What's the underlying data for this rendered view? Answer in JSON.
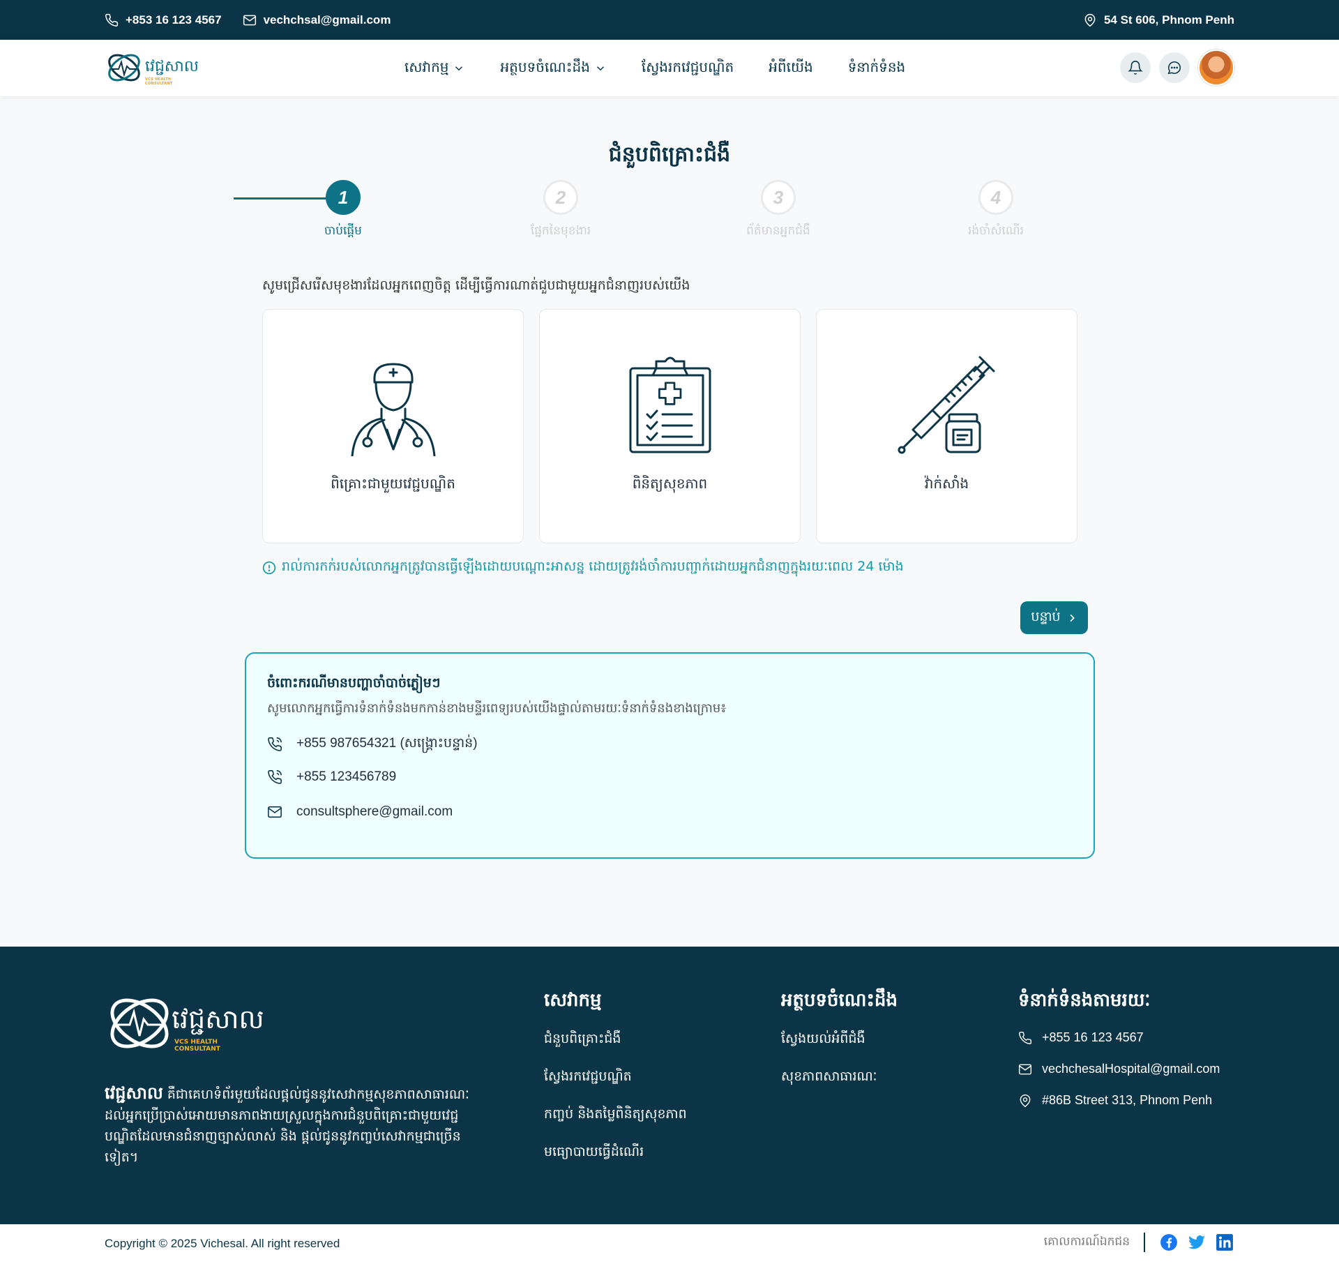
{
  "topbar": {
    "phone": "+853 16 123 4567",
    "email": "vechchsal@gmail.com",
    "address": "54 St 606, Phnom Penh"
  },
  "nav": {
    "logo_text": "វេជ្ជសាល",
    "logo_sub": "VCS HEALTH CONSULTANT",
    "menu": [
      "សេវាកម្ម",
      "អត្ថបទចំណេះដឹង",
      "ស្វែងរកវេជ្ជបណ្ឌិត",
      "អំពីយើង",
      "ទំនាក់ទំនង"
    ]
  },
  "page": {
    "title": "ជំនួបពិគ្រោះជំងឺ",
    "steps": [
      {
        "num": "1",
        "label": "ចាប់ផ្តើម"
      },
      {
        "num": "2",
        "label": "ផ្នែកនៃមុខងារ"
      },
      {
        "num": "3",
        "label": "ព័ត៌មានអ្នកជំងឺ"
      },
      {
        "num": "4",
        "label": "រង់ចាំសំណើរ"
      }
    ],
    "prompt": "សូមជ្រើសរើសមុខងារដែលអ្នកពេញចិត្ត ដើម្បីធ្វើការណាត់ជួបជាមួយអ្នកជំនាញរបស់យើង",
    "cards": [
      {
        "label": "ពិគ្រោះជាមួយវេជ្ជបណ្ឌិត",
        "icon": "doctor-icon"
      },
      {
        "label": "ពិនិត្យសុខភាព",
        "icon": "clipboard-icon"
      },
      {
        "label": "វ៉ាក់សាំង",
        "icon": "syringe-icon"
      }
    ],
    "notice": "រាល់ការកក់របស់លោកអ្នកត្រូវបានធ្វើឡើងដោយបណ្តោះអាសន្ន ដោយត្រូវរង់ចាំការបញ្ជាក់ដោយអ្នកជំនាញក្នុងរយៈពេល 24 ម៉ោង",
    "next_label": "បន្ទាប់"
  },
  "emergency": {
    "title": "ចំពោះករណីមានបញ្ហាចាំបាច់ភ្លៀមៗ",
    "desc": "សូមលោកអ្នកធ្វើការទំនាក់ទំនងមកកាន់ខាងមន្ទីរពេទ្យរបស់យើងផ្ទាល់តាមរយៈទំនាក់ទំនងខាងក្រោម៖",
    "phone1": "+855 987654321 (សង្គ្រោះបន្ទាន់)",
    "phone2": "+855 123456789",
    "email": "consultsphere@gmail.com"
  },
  "footer": {
    "logo_text": "វេជ្ជសាល",
    "logo_sub": "VCS HEALTH CONSULTANT",
    "about_brand": "វេជ្ជសាល",
    "about": "គឺជាគេហទំព័រមួយដែលផ្តល់ជូននូវសេវាកម្មសុខភាពសាធារណៈ ដល់អ្នកប្រើប្រាស់អោយមានភាពងាយស្រួលក្នុងការជំនួបពិគ្រោះជាមួយវេជ្ជបណ្ឌិតដែលមានជំនាញច្បាស់លាស់ និង ផ្តល់ជូននូវកញ្ចប់សេវាកម្មជាច្រើនទៀត។",
    "services_title": "សេវាកម្ម",
    "services": [
      "ជំនួបពិគ្រោះជំងឺ",
      "ស្វែងរកវេជ្ជបណ្ឌិត",
      "កញ្ចប់ និងតម្លៃពិនិត្យសុខភាព",
      "មធ្យោបាយធ្វើដំណើរ"
    ],
    "articles_title": "អត្ថបទចំណេះដឹង",
    "articles": [
      "ស្វែងយល់អំពីជំងឺ",
      "សុខភាពសាធារណៈ"
    ],
    "contact_title": "ទំនាក់ទំនងតាមរយៈ",
    "contact_phone": "+855 16 123 4567",
    "contact_email": "vechchesalHospital@gmail.com",
    "contact_address": "#86B Street 313, Phnom Penh"
  },
  "bottom": {
    "copyright": "Copyright © 2025 Vichesal. All right reserved",
    "policy": "គោលការណ៍ឯកជន"
  },
  "colors": {
    "primary_dark": "#0b3547",
    "accent": "#0f7387",
    "notice": "#0f9aa8"
  }
}
